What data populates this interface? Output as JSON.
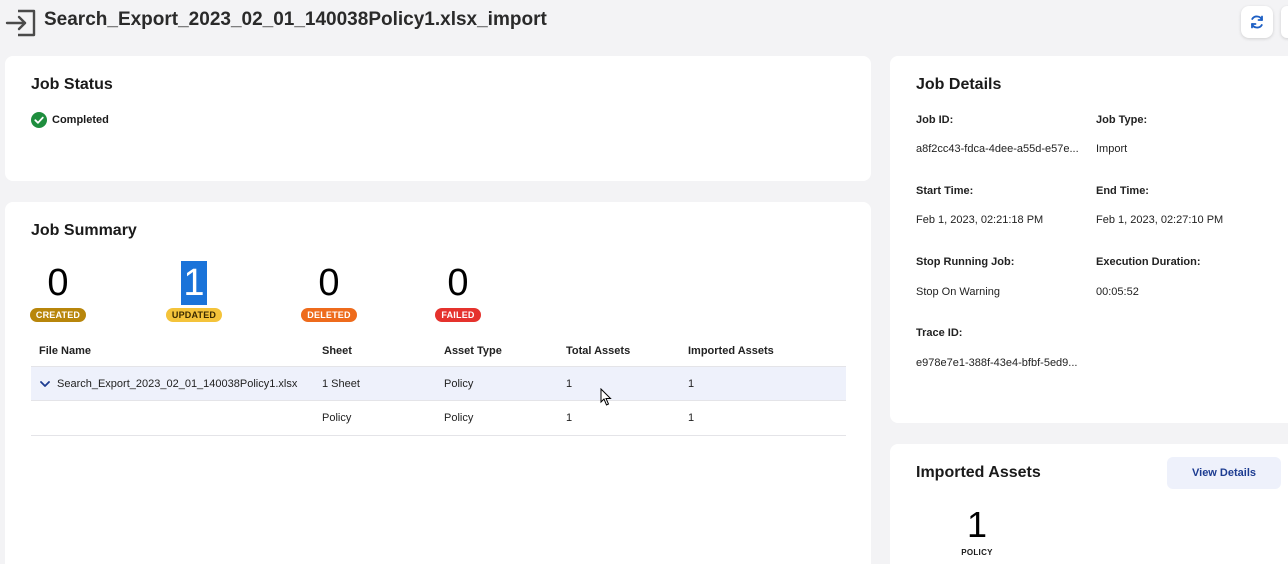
{
  "header": {
    "title": "Search_Export_2023_02_01_140038Policy1.xlsx_import",
    "import_icon": "import-icon",
    "refresh_icon": "refresh-icon"
  },
  "job_status": {
    "title": "Job Status",
    "status": "Completed",
    "status_color": "#1e8e3e"
  },
  "job_summary": {
    "title": "Job Summary",
    "counters": [
      {
        "value": "0",
        "label": "CREATED",
        "color": "#b8860b"
      },
      {
        "value": "1",
        "label": "UPDATED",
        "color": "#f4c33a"
      },
      {
        "value": "0",
        "label": "DELETED",
        "color": "#ee6b1c"
      },
      {
        "value": "0",
        "label": "FAILED",
        "color": "#e5322d"
      }
    ],
    "columns": [
      "File Name",
      "Sheet",
      "Asset Type",
      "Total Assets",
      "Imported Assets"
    ],
    "rows": [
      {
        "file": "Search_Export_2023_02_01_140038Policy1.xlsx",
        "sheet": "1 Sheet",
        "type": "Policy",
        "total": "1",
        "imported": "1"
      },
      {
        "file": "",
        "sheet": "Policy",
        "type": "Policy",
        "total": "1",
        "imported": "1"
      }
    ]
  },
  "job_details": {
    "title": "Job Details",
    "job_id_label": "Job ID:",
    "job_id": "a8f2cc43-fdca-4dee-a55d-e57e...",
    "job_type_label": "Job Type:",
    "job_type": "Import",
    "start_label": "Start Time:",
    "start": "Feb 1, 2023, 02:21:18 PM",
    "end_label": "End Time:",
    "end": "Feb 1, 2023, 02:27:10 PM",
    "stop_label": "Stop Running Job:",
    "stop": "Stop On Warning",
    "duration_label": "Execution Duration:",
    "duration": "00:05:52",
    "trace_label": "Trace ID:",
    "trace": "e978e7e1-388f-43e4-bfbf-5ed9..."
  },
  "imported_assets": {
    "title": "Imported Assets",
    "button": "View Details",
    "count": "1",
    "label": "POLICY"
  },
  "colors": {
    "accent": "#1d3c91",
    "highlight": "#1a73d9"
  }
}
